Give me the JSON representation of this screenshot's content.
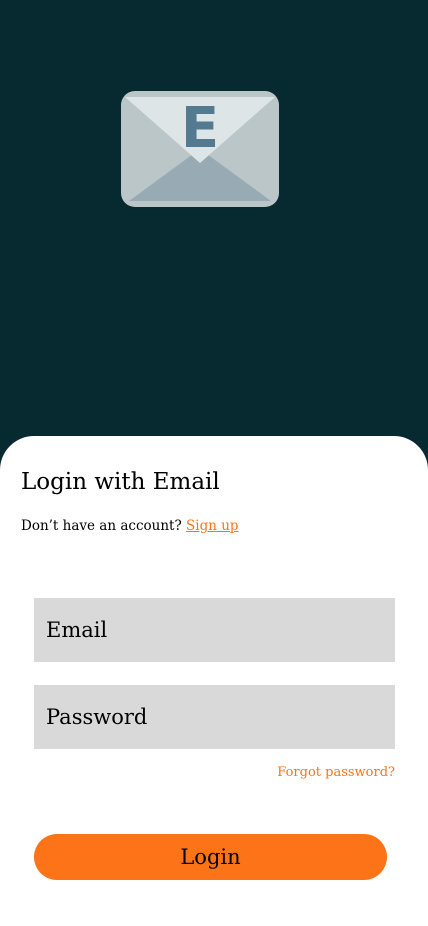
{
  "hero": {
    "icon": "envelope-e-icon",
    "icon_letter": "E",
    "background_color": "#062a30"
  },
  "login": {
    "title": "Login with Email",
    "signup_prompt": "Don’t have an account?",
    "signup_link": "Sign up",
    "email_placeholder": "Email",
    "email_value": "",
    "password_placeholder": "Password",
    "password_value": "",
    "forgot_password": "Forgot password?",
    "login_button": "Login"
  },
  "colors": {
    "accent": "#fc7417",
    "field_background": "#d9d9d9",
    "sheet_background": "#ffffff"
  }
}
